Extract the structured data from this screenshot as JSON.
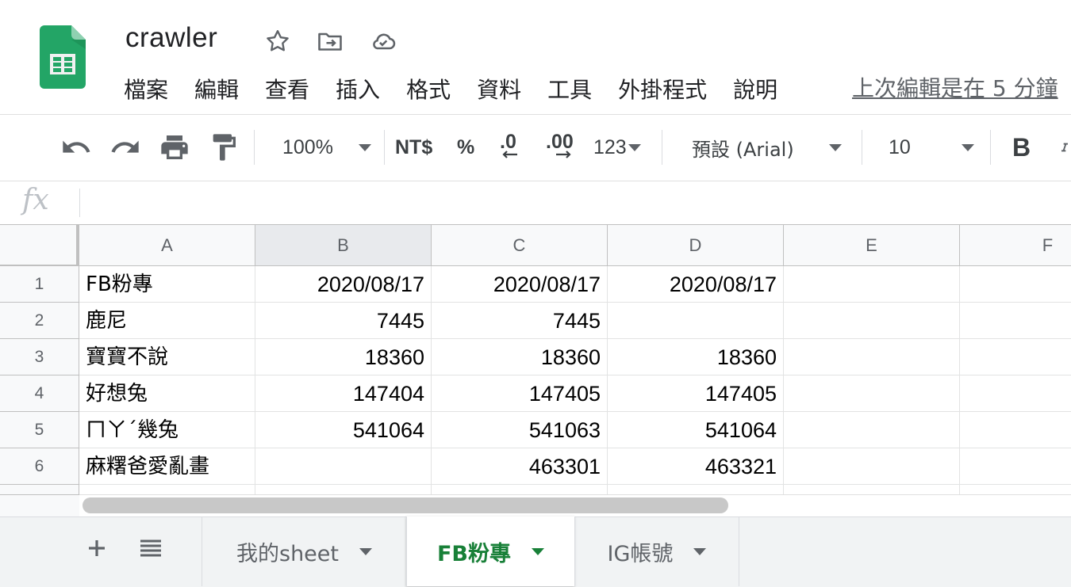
{
  "header": {
    "title": "crawler",
    "icons": [
      "sheets-logo-icon",
      "star-icon",
      "move-to-folder-icon",
      "cloud-saved-icon"
    ],
    "menu": [
      "檔案",
      "編輯",
      "查看",
      "插入",
      "格式",
      "資料",
      "工具",
      "外掛程式",
      "說明"
    ],
    "last_edit": "上次編輯是在 5 分鐘"
  },
  "toolbar": {
    "zoom": "100%",
    "currency": "NT$",
    "percent": "%",
    "decrease_decimal": ".0",
    "increase_decimal": ".00",
    "more_formats": "123",
    "font": "預設 (Arial)",
    "font_size": "10",
    "bold": "B",
    "icons": [
      "undo-icon",
      "redo-icon",
      "print-icon",
      "paint-format-icon"
    ]
  },
  "formula_bar": {
    "label": "fx",
    "value": ""
  },
  "grid": {
    "columns": [
      "A",
      "B",
      "C",
      "D",
      "E",
      "F"
    ],
    "selected_column": "B",
    "rows": [
      {
        "num": "1",
        "cells": [
          "FB粉專",
          "2020/08/17",
          "2020/08/17",
          "2020/08/17",
          "",
          ""
        ]
      },
      {
        "num": "2",
        "cells": [
          "鹿尼",
          "7445",
          "7445",
          "",
          "",
          ""
        ]
      },
      {
        "num": "3",
        "cells": [
          "寶寶不說",
          "18360",
          "18360",
          "18360",
          "",
          ""
        ]
      },
      {
        "num": "4",
        "cells": [
          "好想兔",
          "147404",
          "147405",
          "147405",
          "",
          ""
        ]
      },
      {
        "num": "5",
        "cells": [
          "ㄇㄚˊ幾兔",
          "541064",
          "541063",
          "541064",
          "",
          ""
        ]
      },
      {
        "num": "6",
        "cells": [
          "麻糬爸愛亂畫",
          "",
          "463301",
          "463321",
          "",
          ""
        ]
      }
    ]
  },
  "sheet_tabs": {
    "tabs": [
      {
        "label": "我的sheet",
        "active": false
      },
      {
        "label": "FB粉專",
        "active": true
      },
      {
        "label": "IG帳號",
        "active": false
      }
    ],
    "icons": [
      "add-sheet-icon",
      "all-sheets-icon"
    ]
  },
  "colors": {
    "brand_green": "#0f9d58",
    "active_tab": "#188038",
    "header_bg": "#f8f9fa"
  }
}
